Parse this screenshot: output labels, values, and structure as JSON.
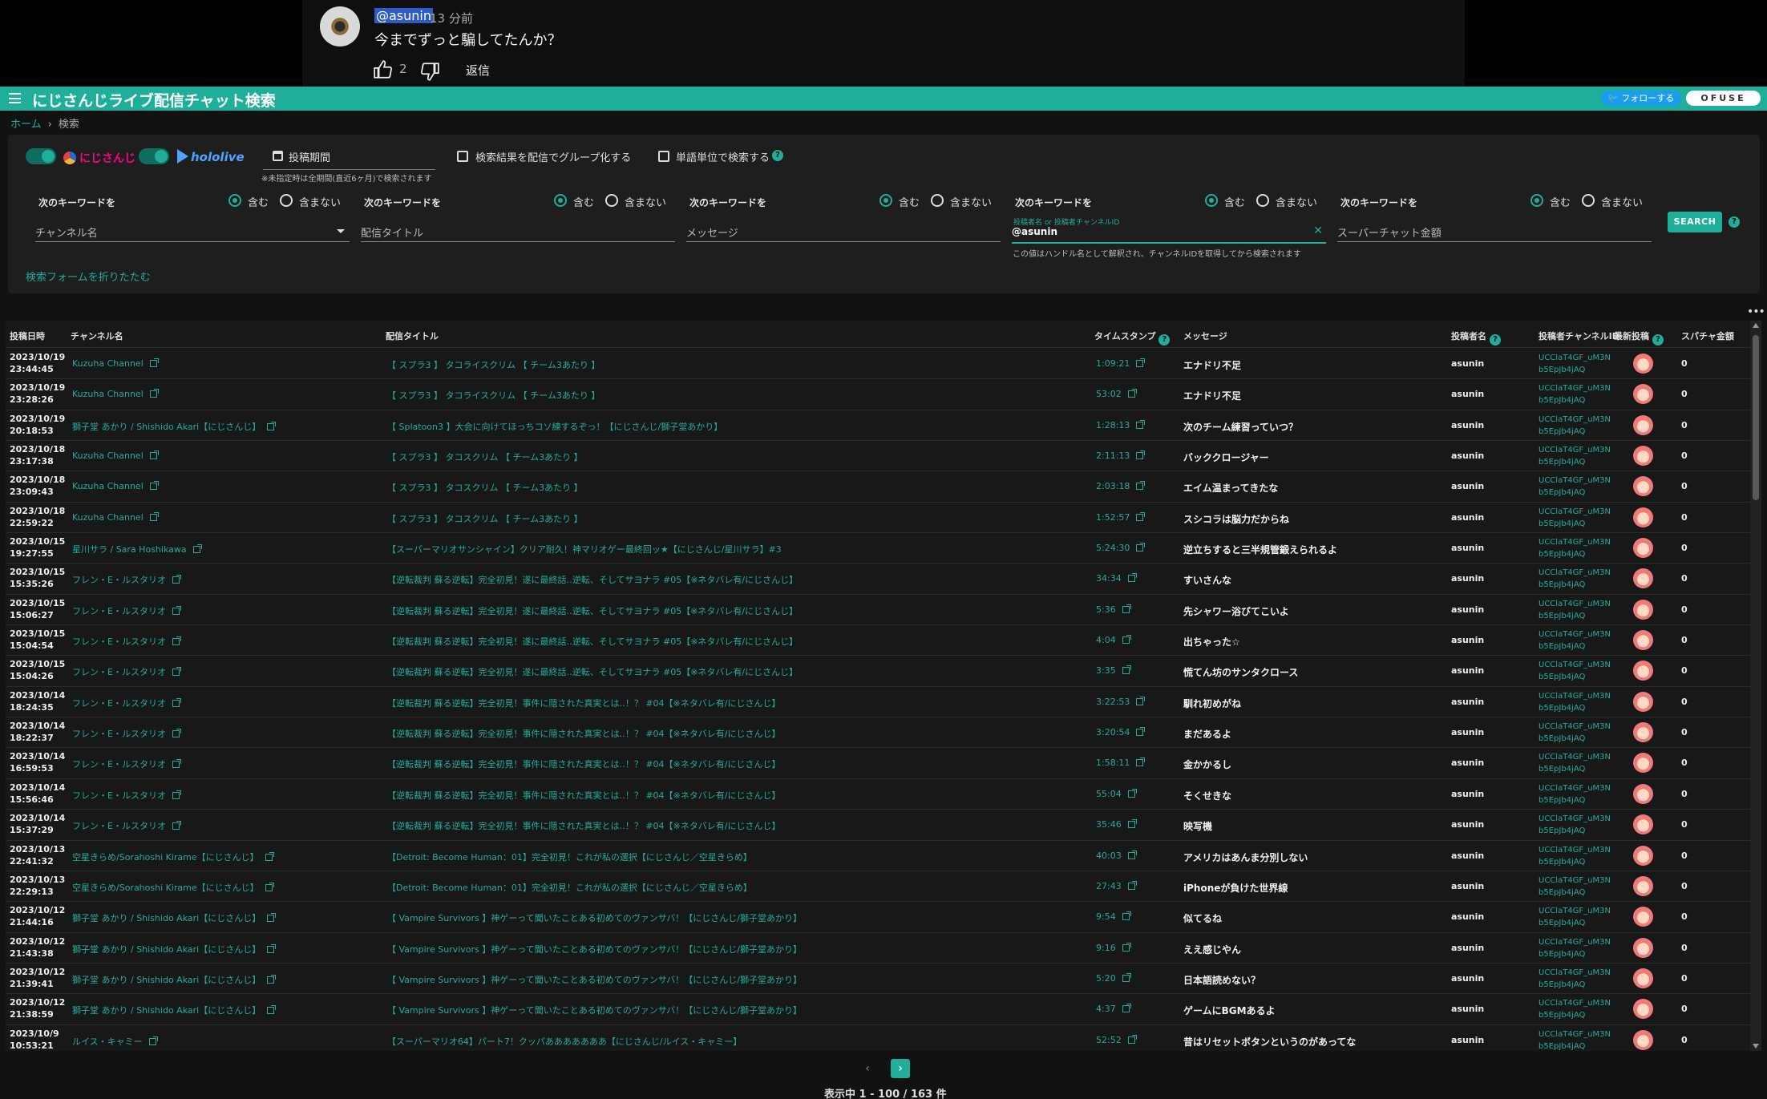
{
  "comment": {
    "handle": "@asunin",
    "time": "13 分前",
    "text": "今までずっと騙してたんか？",
    "like_count": "2",
    "reply_label": "返信"
  },
  "app": {
    "title": "にじさんじライブ配信チャット検索",
    "follow_label": "フォローする",
    "ofuse_label": "OFUSE",
    "accent_color": "#1fae9a"
  },
  "breadcrumb": {
    "home": "ホーム",
    "separator": "›",
    "current": "検索"
  },
  "filters": {
    "nijisanji_label": "にじさんじ",
    "hololive_label": "hololive",
    "date_label": "投稿期間",
    "date_note": "※未指定時は全期間(直近6ヶ月)で検索されます",
    "group_label": "検索結果を配信でグループ化する",
    "word_label": "単語単位で検索する"
  },
  "keywords": {
    "title": "次のキーワードを",
    "include": "含む",
    "exclude": "含まない",
    "fields": [
      {
        "placeholder": "チャンネル名"
      },
      {
        "placeholder": "配信タイトル"
      },
      {
        "placeholder": "メッセージ"
      },
      {
        "float_label": "投稿者名 or 投稿者チャンネルID",
        "value": "@asunin",
        "note": "この値はハンドル名として解釈され、チャンネルIDを取得してから検索されます"
      },
      {
        "placeholder": "スーパーチャット金額"
      }
    ],
    "search_label": "SEARCH",
    "collapse_label": "検索フォームを折りたたむ"
  },
  "table": {
    "headers": {
      "date": "投稿日時",
      "channel": "チャンネル名",
      "title": "配信タイトル",
      "timestamp": "タイムスタンプ",
      "message": "メッセージ",
      "author": "投稿者名",
      "author_id": "投稿者チャンネルID",
      "latest": "最新投稿",
      "superchat": "スパチャ金額"
    },
    "rows": [
      {
        "date": "2023/10/19",
        "time": "23:44:45",
        "channel": "Kuzuha Channel",
        "title": "【 スプラ3 】 タコライスクリム 【 チーム3あたり 】",
        "ts": "1:09:21",
        "msg": "エナドリ不足",
        "author": "asunin",
        "id1": "UCClaT4GF_uM3N",
        "id2": "b5EpJb4jAQ",
        "amt": "0"
      },
      {
        "date": "2023/10/19",
        "time": "23:28:26",
        "channel": "Kuzuha Channel",
        "title": "【 スプラ3 】 タコライスクリム 【 チーム3あたり 】",
        "ts": "53:02",
        "msg": "エナドリ不足",
        "author": "asunin",
        "id1": "UCClaT4GF_uM3N",
        "id2": "b5EpJb4jAQ",
        "amt": "0"
      },
      {
        "date": "2023/10/19",
        "time": "20:18:53",
        "channel": "獅子堂 あかり / Shishido Akari【にじさんじ】",
        "title": "【 Splatoon3 】大会に向けてほっちコソ練するぞっ！【にじさんじ/獅子堂あかり】",
        "ts": "1:28:13",
        "msg": "次のチーム練習っていつ？",
        "author": "asunin",
        "id1": "UCClaT4GF_uM3N",
        "id2": "b5EpJb4jAQ",
        "amt": "0"
      },
      {
        "date": "2023/10/18",
        "time": "23:17:38",
        "channel": "Kuzuha Channel",
        "title": "【 スプラ3 】 タコスクリム 【 チーム3あたり 】",
        "ts": "2:11:13",
        "msg": "バッククロージャー",
        "author": "asunin",
        "id1": "UCClaT4GF_uM3N",
        "id2": "b5EpJb4jAQ",
        "amt": "0"
      },
      {
        "date": "2023/10/18",
        "time": "23:09:43",
        "channel": "Kuzuha Channel",
        "title": "【 スプラ3 】 タコスクリム 【 チーム3あたり 】",
        "ts": "2:03:18",
        "msg": "エイム温まってきたな",
        "author": "asunin",
        "id1": "UCClaT4GF_uM3N",
        "id2": "b5EpJb4jAQ",
        "amt": "0"
      },
      {
        "date": "2023/10/18",
        "time": "22:59:22",
        "channel": "Kuzuha Channel",
        "title": "【 スプラ3 】 タコスクリム 【 チーム3あたり 】",
        "ts": "1:52:57",
        "msg": "スシコラは脳力だからね",
        "author": "asunin",
        "id1": "UCClaT4GF_uM3N",
        "id2": "b5EpJb4jAQ",
        "amt": "0"
      },
      {
        "date": "2023/10/15",
        "time": "19:27:55",
        "channel": "星川サラ / Sara Hoshikawa",
        "title": "【スーパーマリオサンシャイン】クリア耐久！神マリオゲー最終回ッ★【にじさんじ/星川サラ】#3",
        "ts": "5:24:30",
        "msg": "逆立ちすると三半規管鍛えられるよ",
        "author": "asunin",
        "id1": "UCClaT4GF_uM3N",
        "id2": "b5EpJb4jAQ",
        "amt": "0"
      },
      {
        "date": "2023/10/15",
        "time": "15:35:26",
        "channel": "フレン・E・ルスタリオ",
        "title": "【逆転裁判 蘇る逆転】完全初見！遂に最終話‥逆転、そしてサヨナラ #05【※ネタバレ有/にじさんじ】",
        "ts": "34:34",
        "msg": "すいさんな",
        "author": "asunin",
        "id1": "UCClaT4GF_uM3N",
        "id2": "b5EpJb4jAQ",
        "amt": "0"
      },
      {
        "date": "2023/10/15",
        "time": "15:06:27",
        "channel": "フレン・E・ルスタリオ",
        "title": "【逆転裁判 蘇る逆転】完全初見！遂に最終話‥逆転、そしてサヨナラ #05【※ネタバレ有/にじさんじ】",
        "ts": "5:36",
        "msg": "先シャワー浴びてこいよ",
        "author": "asunin",
        "id1": "UCClaT4GF_uM3N",
        "id2": "b5EpJb4jAQ",
        "amt": "0"
      },
      {
        "date": "2023/10/15",
        "time": "15:04:54",
        "channel": "フレン・E・ルスタリオ",
        "title": "【逆転裁判 蘇る逆転】完全初見！遂に最終話‥逆転、そしてサヨナラ #05【※ネタバレ有/にじさんじ】",
        "ts": "4:04",
        "msg": "出ちゃった☆",
        "author": "asunin",
        "id1": "UCClaT4GF_uM3N",
        "id2": "b5EpJb4jAQ",
        "amt": "0"
      },
      {
        "date": "2023/10/15",
        "time": "15:04:26",
        "channel": "フレン・E・ルスタリオ",
        "title": "【逆転裁判 蘇る逆転】完全初見！遂に最終話‥逆転、そしてサヨナラ #05【※ネタバレ有/にじさんじ】",
        "ts": "3:35",
        "msg": "慌てん坊のサンタクロース",
        "author": "asunin",
        "id1": "UCClaT4GF_uM3N",
        "id2": "b5EpJb4jAQ",
        "amt": "0"
      },
      {
        "date": "2023/10/14",
        "time": "18:24:35",
        "channel": "フレン・E・ルスタリオ",
        "title": "【逆転裁判 蘇る逆転】完全初見！事件に隠された真実とは‥！？ #04【※ネタバレ有/にじさんじ】",
        "ts": "3:22:53",
        "msg": "馴れ初めがね",
        "author": "asunin",
        "id1": "UCClaT4GF_uM3N",
        "id2": "b5EpJb4jAQ",
        "amt": "0"
      },
      {
        "date": "2023/10/14",
        "time": "18:22:37",
        "channel": "フレン・E・ルスタリオ",
        "title": "【逆転裁判 蘇る逆転】完全初見！事件に隠された真実とは‥！？ #04【※ネタバレ有/にじさんじ】",
        "ts": "3:20:54",
        "msg": "まだあるよ",
        "author": "asunin",
        "id1": "UCClaT4GF_uM3N",
        "id2": "b5EpJb4jAQ",
        "amt": "0"
      },
      {
        "date": "2023/10/14",
        "time": "16:59:53",
        "channel": "フレン・E・ルスタリオ",
        "title": "【逆転裁判 蘇る逆転】完全初見！事件に隠された真実とは‥！？ #04【※ネタバレ有/にじさんじ】",
        "ts": "1:58:11",
        "msg": "金かかるし",
        "author": "asunin",
        "id1": "UCClaT4GF_uM3N",
        "id2": "b5EpJb4jAQ",
        "amt": "0"
      },
      {
        "date": "2023/10/14",
        "time": "15:56:46",
        "channel": "フレン・E・ルスタリオ",
        "title": "【逆転裁判 蘇る逆転】完全初見！事件に隠された真実とは‥！？ #04【※ネタバレ有/にじさんじ】",
        "ts": "55:04",
        "msg": "そくせきな",
        "author": "asunin",
        "id1": "UCClaT4GF_uM3N",
        "id2": "b5EpJb4jAQ",
        "amt": "0"
      },
      {
        "date": "2023/10/14",
        "time": "15:37:29",
        "channel": "フレン・E・ルスタリオ",
        "title": "【逆転裁判 蘇る逆転】完全初見！事件に隠された真実とは‥！？ #04【※ネタバレ有/にじさんじ】",
        "ts": "35:46",
        "msg": "映写機",
        "author": "asunin",
        "id1": "UCClaT4GF_uM3N",
        "id2": "b5EpJb4jAQ",
        "amt": "0"
      },
      {
        "date": "2023/10/13",
        "time": "22:41:32",
        "channel": "空星きらめ/Sorahoshi Kirame【にじさんじ】",
        "title": "【Detroit: Become Human：01】完全初見！これが私の選択【にじさんじ／空星きらめ】",
        "ts": "40:03",
        "msg": "アメリカはあんま分別しない",
        "author": "asunin",
        "id1": "UCClaT4GF_uM3N",
        "id2": "b5EpJb4jAQ",
        "amt": "0"
      },
      {
        "date": "2023/10/13",
        "time": "22:29:13",
        "channel": "空星きらめ/Sorahoshi Kirame【にじさんじ】",
        "title": "【Detroit: Become Human：01】完全初見！これが私の選択【にじさんじ／空星きらめ】",
        "ts": "27:43",
        "msg": "iPhoneが負けた世界線",
        "author": "asunin",
        "id1": "UCClaT4GF_uM3N",
        "id2": "b5EpJb4jAQ",
        "amt": "0"
      },
      {
        "date": "2023/10/12",
        "time": "21:44:16",
        "channel": "獅子堂 あかり / Shishido Akari【にじさんじ】",
        "title": "【 Vampire Survivors 】神ゲーって聞いたことある初めてのヴァンサバ！【にじさんじ/獅子堂あかり】",
        "ts": "9:54",
        "msg": "似てるね",
        "author": "asunin",
        "id1": "UCClaT4GF_uM3N",
        "id2": "b5EpJb4jAQ",
        "amt": "0"
      },
      {
        "date": "2023/10/12",
        "time": "21:43:38",
        "channel": "獅子堂 あかり / Shishido Akari【にじさんじ】",
        "title": "【 Vampire Survivors 】神ゲーって聞いたことある初めてのヴァンサバ！【にじさんじ/獅子堂あかり】",
        "ts": "9:16",
        "msg": "ええ感じやん",
        "author": "asunin",
        "id1": "UCClaT4GF_uM3N",
        "id2": "b5EpJb4jAQ",
        "amt": "0"
      },
      {
        "date": "2023/10/12",
        "time": "21:39:41",
        "channel": "獅子堂 あかり / Shishido Akari【にじさんじ】",
        "title": "【 Vampire Survivors 】神ゲーって聞いたことある初めてのヴァンサバ！【にじさんじ/獅子堂あかり】",
        "ts": "5:20",
        "msg": "日本語読めない？",
        "author": "asunin",
        "id1": "UCClaT4GF_uM3N",
        "id2": "b5EpJb4jAQ",
        "amt": "0"
      },
      {
        "date": "2023/10/12",
        "time": "21:38:59",
        "channel": "獅子堂 あかり / Shishido Akari【にじさんじ】",
        "title": "【 Vampire Survivors 】神ゲーって聞いたことある初めてのヴァンサバ！【にじさんじ/獅子堂あかり】",
        "ts": "4:37",
        "msg": "ゲームにBGMあるよ",
        "author": "asunin",
        "id1": "UCClaT4GF_uM3N",
        "id2": "b5EpJb4jAQ",
        "amt": "0"
      },
      {
        "date": "2023/10/9",
        "time": "10:53:21",
        "channel": "ルイス・キャミー",
        "title": "【スーパーマリオ64】パート7！クッパあああああああ【にじさんじ/ルイス・キャミー】",
        "ts": "52:52",
        "msg": "昔はリセットボタンというのがあってな",
        "author": "asunin",
        "id1": "UCClaT4GF_uM3N",
        "id2": "b5EpJb4jAQ",
        "amt": "0"
      }
    ]
  },
  "pagination": {
    "prev": "‹",
    "next": "›",
    "status": "表示中 1 - 100 / 163 件"
  }
}
